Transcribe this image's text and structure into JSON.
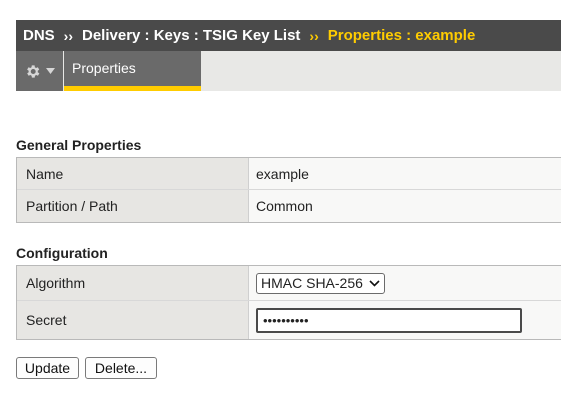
{
  "breadcrumb": {
    "segment_1": "DNS",
    "sep_1": "››",
    "segment_2": "Delivery : Keys : TSIG Key List",
    "sep_2": "››",
    "current": "Properties : example",
    "current_color": "#ffcc00"
  },
  "tabs": {
    "gear_icon": "gear-icon",
    "properties_label": "Properties",
    "active_underline_color": "#ffcc00"
  },
  "general": {
    "title": "General Properties",
    "rows": [
      {
        "label": "Name",
        "value": "example"
      },
      {
        "label": "Partition / Path",
        "value": "Common"
      }
    ]
  },
  "configuration": {
    "title": "Configuration",
    "algorithm_label": "Algorithm",
    "algorithm_value": "HMAC SHA-256",
    "secret_label": "Secret",
    "secret_value": "••••••••••"
  },
  "actions": {
    "update_label": "Update",
    "delete_label": "Delete..."
  }
}
